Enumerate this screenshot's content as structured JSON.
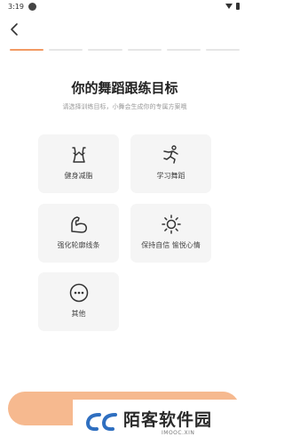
{
  "status": {
    "time": "3:19"
  },
  "header": {
    "back_icon": "chevron-left-icon"
  },
  "progress": {
    "total_steps": 6,
    "current_step": 1
  },
  "page": {
    "title": "你的舞蹈跟练目标",
    "subtitle": "请选择训练目标，小舞会生成你的专属方案哦"
  },
  "goals": [
    {
      "label": "健身减脂",
      "icon": "waist-body-icon"
    },
    {
      "label": "学习舞蹈",
      "icon": "dancer-icon"
    },
    {
      "label": "强化轮廓线条",
      "icon": "flexed-arm-icon"
    },
    {
      "label": "保持自信 愉悦心情",
      "icon": "sun-icon"
    },
    {
      "label": "其他",
      "icon": "more-dots-icon"
    }
  ],
  "colors": {
    "accent": "#f29a63",
    "button": "#f6b98f",
    "card_bg": "#f5f5f5"
  },
  "watermark": {
    "title": "陌客软件园",
    "subtitle": "IMOOC.XIN"
  }
}
